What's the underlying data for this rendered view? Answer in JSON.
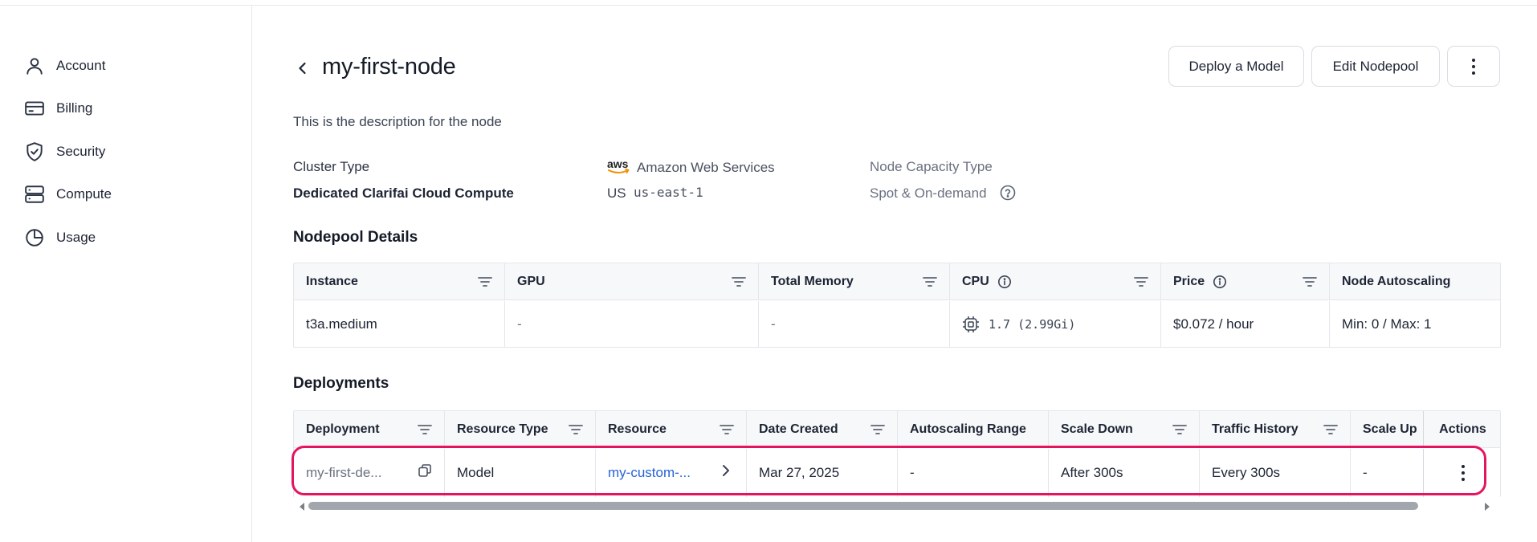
{
  "sidebar": {
    "items": [
      {
        "label": "Account",
        "icon": "user-icon"
      },
      {
        "label": "Billing",
        "icon": "credit-card-icon"
      },
      {
        "label": "Security",
        "icon": "shield-check-icon"
      },
      {
        "label": "Compute",
        "icon": "server-icon"
      },
      {
        "label": "Usage",
        "icon": "pie-chart-icon"
      }
    ]
  },
  "header": {
    "title": "my-first-node",
    "deploy_label": "Deploy a Model",
    "edit_label": "Edit Nodepool"
  },
  "description": "This is the description for the node",
  "cluster": {
    "type_label": "Cluster Type",
    "type_value": "Dedicated Clarifai Cloud Compute",
    "provider_logo": "aws",
    "provider": "Amazon Web Services",
    "region_code": "US",
    "region": "us-east-1",
    "capacity_label": "Node Capacity Type",
    "capacity_value": "Spot & On-demand"
  },
  "nodepool": {
    "title": "Nodepool Details",
    "columns": [
      "Instance",
      "GPU",
      "Total Memory",
      "CPU",
      "Price",
      "Node Autoscaling"
    ],
    "row": {
      "instance": "t3a.medium",
      "gpu": "-",
      "memory": "-",
      "cpu": "1.7 (2.99Gi)",
      "price": "$0.072 / hour",
      "autoscaling": "Min: 0 / Max: 1"
    }
  },
  "deployments": {
    "title": "Deployments",
    "columns": [
      "Deployment",
      "Resource Type",
      "Resource",
      "Date Created",
      "Autoscaling Range",
      "Scale Down",
      "Traffic History",
      "Scale Up",
      "Actions"
    ],
    "row": {
      "deployment": "my-first-de...",
      "resource_type": "Model",
      "resource": "my-custom-...",
      "date_created": "Mar 27, 2025",
      "autoscaling_range": "-",
      "scale_down": "After 300s",
      "traffic_history": "Every 300s",
      "scale_up": "-"
    }
  },
  "colors": {
    "highlight": "#e3155f",
    "link": "#2563d6"
  }
}
